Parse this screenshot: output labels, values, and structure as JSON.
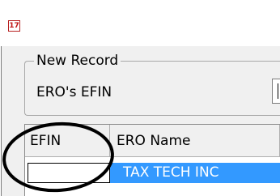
{
  "window": {
    "icon": "app-calendar-icon",
    "icon_glyph": "17"
  },
  "form": {
    "group_title": "New Record",
    "efin_label": "ERO's EFIN",
    "efin_value": ""
  },
  "grid": {
    "columns": [
      "EFIN",
      "ERO Name"
    ],
    "rows": [
      {
        "efin": "",
        "ero_name": "TAX TECH INC",
        "selected": true
      }
    ]
  },
  "colors": {
    "selection": "#3399ff",
    "annotation": "#000000"
  }
}
